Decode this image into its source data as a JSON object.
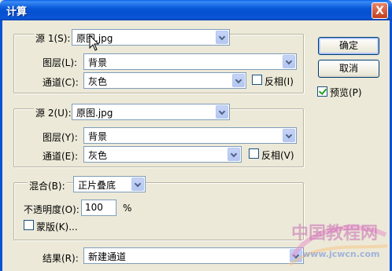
{
  "window": {
    "title": "计算",
    "close_glyph": "X"
  },
  "source1": {
    "label": "源 1(S):",
    "file": "原图.jpg",
    "layer_label": "图层(L):",
    "layer": "背景",
    "channel_label": "通道(C):",
    "channel": "灰色",
    "invert_label": "反相(I)",
    "invert_checked": false
  },
  "source2": {
    "label": "源 2(U):",
    "file": "原图.jpg",
    "layer_label": "图层(Y):",
    "layer": "背景",
    "channel_label": "通道(E):",
    "channel": "灰色",
    "invert_label": "反相(V)",
    "invert_checked": false
  },
  "blend": {
    "label": "混合(B):",
    "mode": "正片叠底",
    "opacity_label": "不透明度(O):",
    "opacity_value": "100",
    "opacity_unit": "%",
    "mask_label": "蒙版(K)...",
    "mask_checked": false
  },
  "result": {
    "label": "结果(R):",
    "value": "新建通道"
  },
  "buttons": {
    "ok": "确定",
    "cancel": "取消"
  },
  "preview": {
    "label": "预览(P)",
    "checked": true
  },
  "watermark": {
    "line1": "中国教程网",
    "line2": "www.jcwcn.com"
  },
  "colors": {
    "title_bar": "#0a59d8",
    "dialog_bg": "#ece9d8",
    "field_border": "#7f9db9"
  }
}
